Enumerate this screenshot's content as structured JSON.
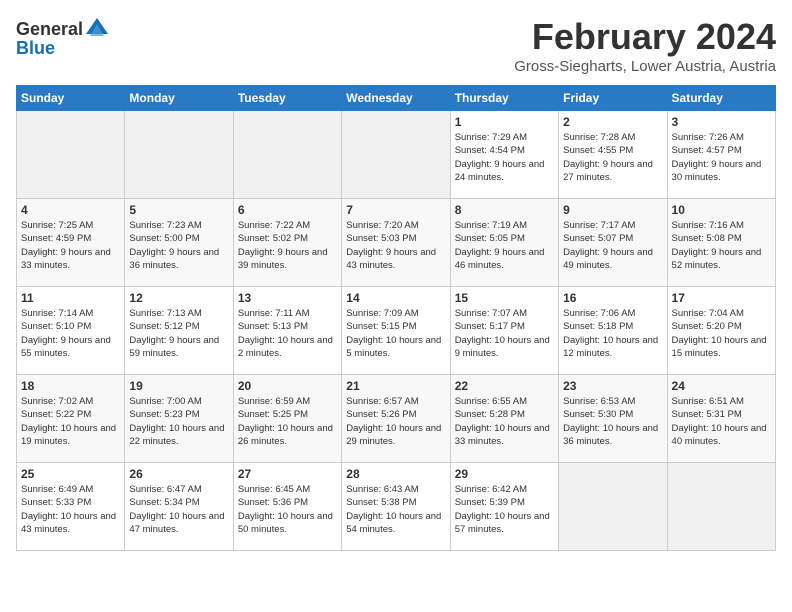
{
  "logo": {
    "general": "General",
    "blue": "Blue"
  },
  "title": "February 2024",
  "subtitle": "Gross-Siegharts, Lower Austria, Austria",
  "headers": [
    "Sunday",
    "Monday",
    "Tuesday",
    "Wednesday",
    "Thursday",
    "Friday",
    "Saturday"
  ],
  "weeks": [
    [
      {
        "day": "",
        "empty": true
      },
      {
        "day": "",
        "empty": true
      },
      {
        "day": "",
        "empty": true
      },
      {
        "day": "",
        "empty": true
      },
      {
        "day": "1",
        "sunrise": "7:29 AM",
        "sunset": "4:54 PM",
        "daylight": "9 hours and 24 minutes."
      },
      {
        "day": "2",
        "sunrise": "7:28 AM",
        "sunset": "4:55 PM",
        "daylight": "9 hours and 27 minutes."
      },
      {
        "day": "3",
        "sunrise": "7:26 AM",
        "sunset": "4:57 PM",
        "daylight": "9 hours and 30 minutes."
      }
    ],
    [
      {
        "day": "4",
        "sunrise": "7:25 AM",
        "sunset": "4:59 PM",
        "daylight": "9 hours and 33 minutes."
      },
      {
        "day": "5",
        "sunrise": "7:23 AM",
        "sunset": "5:00 PM",
        "daylight": "9 hours and 36 minutes."
      },
      {
        "day": "6",
        "sunrise": "7:22 AM",
        "sunset": "5:02 PM",
        "daylight": "9 hours and 39 minutes."
      },
      {
        "day": "7",
        "sunrise": "7:20 AM",
        "sunset": "5:03 PM",
        "daylight": "9 hours and 43 minutes."
      },
      {
        "day": "8",
        "sunrise": "7:19 AM",
        "sunset": "5:05 PM",
        "daylight": "9 hours and 46 minutes."
      },
      {
        "day": "9",
        "sunrise": "7:17 AM",
        "sunset": "5:07 PM",
        "daylight": "9 hours and 49 minutes."
      },
      {
        "day": "10",
        "sunrise": "7:16 AM",
        "sunset": "5:08 PM",
        "daylight": "9 hours and 52 minutes."
      }
    ],
    [
      {
        "day": "11",
        "sunrise": "7:14 AM",
        "sunset": "5:10 PM",
        "daylight": "9 hours and 55 minutes."
      },
      {
        "day": "12",
        "sunrise": "7:13 AM",
        "sunset": "5:12 PM",
        "daylight": "9 hours and 59 minutes."
      },
      {
        "day": "13",
        "sunrise": "7:11 AM",
        "sunset": "5:13 PM",
        "daylight": "10 hours and 2 minutes."
      },
      {
        "day": "14",
        "sunrise": "7:09 AM",
        "sunset": "5:15 PM",
        "daylight": "10 hours and 5 minutes."
      },
      {
        "day": "15",
        "sunrise": "7:07 AM",
        "sunset": "5:17 PM",
        "daylight": "10 hours and 9 minutes."
      },
      {
        "day": "16",
        "sunrise": "7:06 AM",
        "sunset": "5:18 PM",
        "daylight": "10 hours and 12 minutes."
      },
      {
        "day": "17",
        "sunrise": "7:04 AM",
        "sunset": "5:20 PM",
        "daylight": "10 hours and 15 minutes."
      }
    ],
    [
      {
        "day": "18",
        "sunrise": "7:02 AM",
        "sunset": "5:22 PM",
        "daylight": "10 hours and 19 minutes."
      },
      {
        "day": "19",
        "sunrise": "7:00 AM",
        "sunset": "5:23 PM",
        "daylight": "10 hours and 22 minutes."
      },
      {
        "day": "20",
        "sunrise": "6:59 AM",
        "sunset": "5:25 PM",
        "daylight": "10 hours and 26 minutes."
      },
      {
        "day": "21",
        "sunrise": "6:57 AM",
        "sunset": "5:26 PM",
        "daylight": "10 hours and 29 minutes."
      },
      {
        "day": "22",
        "sunrise": "6:55 AM",
        "sunset": "5:28 PM",
        "daylight": "10 hours and 33 minutes."
      },
      {
        "day": "23",
        "sunrise": "6:53 AM",
        "sunset": "5:30 PM",
        "daylight": "10 hours and 36 minutes."
      },
      {
        "day": "24",
        "sunrise": "6:51 AM",
        "sunset": "5:31 PM",
        "daylight": "10 hours and 40 minutes."
      }
    ],
    [
      {
        "day": "25",
        "sunrise": "6:49 AM",
        "sunset": "5:33 PM",
        "daylight": "10 hours and 43 minutes."
      },
      {
        "day": "26",
        "sunrise": "6:47 AM",
        "sunset": "5:34 PM",
        "daylight": "10 hours and 47 minutes."
      },
      {
        "day": "27",
        "sunrise": "6:45 AM",
        "sunset": "5:36 PM",
        "daylight": "10 hours and 50 minutes."
      },
      {
        "day": "28",
        "sunrise": "6:43 AM",
        "sunset": "5:38 PM",
        "daylight": "10 hours and 54 minutes."
      },
      {
        "day": "29",
        "sunrise": "6:42 AM",
        "sunset": "5:39 PM",
        "daylight": "10 hours and 57 minutes."
      },
      {
        "day": "",
        "empty": true
      },
      {
        "day": "",
        "empty": true
      }
    ]
  ]
}
